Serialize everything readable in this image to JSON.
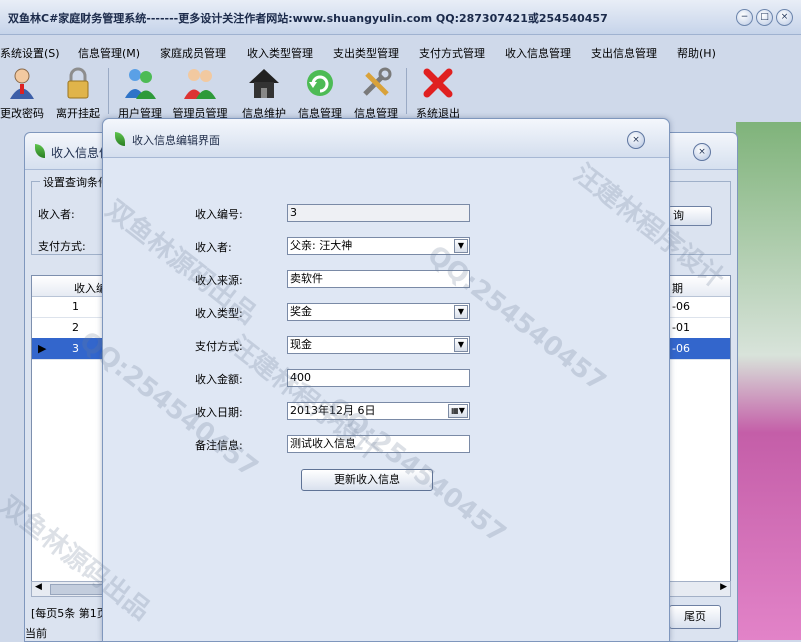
{
  "app": {
    "title": "双鱼林C#家庭财务管理系统-------更多设计关注作者网站:www.shuangyulin.com  QQ:287307421或254540457"
  },
  "window_controls": {
    "minimize": "−",
    "maximize": "□",
    "close": "×"
  },
  "menu": [
    "系统设置(S)",
    "信息管理(M)",
    "家庭成员管理",
    "收入类型管理",
    "支出类型管理",
    "支付方式管理",
    "收入信息管理",
    "支出信息管理",
    "帮助(H)"
  ],
  "toolbar": [
    "更改密码",
    "离开挂起",
    "用户管理",
    "管理员管理",
    "信息维护",
    "信息管理",
    "信息管理",
    "系统退出"
  ],
  "back_window": {
    "title": "收入信息信",
    "query_group": "设置查询条件",
    "filter_labels": [
      "收入者:",
      "支付方式:"
    ],
    "query_button": "询",
    "grid_header": [
      "收入编",
      "期"
    ],
    "rows": [
      {
        "id": "1",
        "date": "-06"
      },
      {
        "id": "2",
        "date": "-01"
      },
      {
        "id": "3",
        "date": "-06"
      }
    ],
    "row_marker": "▶",
    "pager": "[每页5条  第1页",
    "status": "当前",
    "last_page_button": "尾页"
  },
  "dialog": {
    "title": "收入信息编辑界面",
    "close": "×",
    "fields": {
      "income_no": {
        "label": "收入编号:",
        "value": "3"
      },
      "earner": {
        "label": "收入者:",
        "value": "父亲: 汪大神"
      },
      "source": {
        "label": "收入来源:",
        "value": "卖软件"
      },
      "income_type": {
        "label": "收入类型:",
        "value": "奖金"
      },
      "pay_method": {
        "label": "支付方式:",
        "value": "现金"
      },
      "amount": {
        "label": "收入金额:",
        "value": "400"
      },
      "date": {
        "label": "收入日期:",
        "value": "2013年12月 6日"
      },
      "remark": {
        "label": "备注信息:",
        "value": "测试收入信息"
      }
    },
    "update_button": "更新收入信息"
  },
  "watermarks": [
    "双鱼林源码出品",
    "QQ:254540457",
    "汪建林程序设计",
    "QQ:254540457",
    "双鱼林源码出品",
    "汪建林程序设计",
    "QQ:254540457"
  ]
}
